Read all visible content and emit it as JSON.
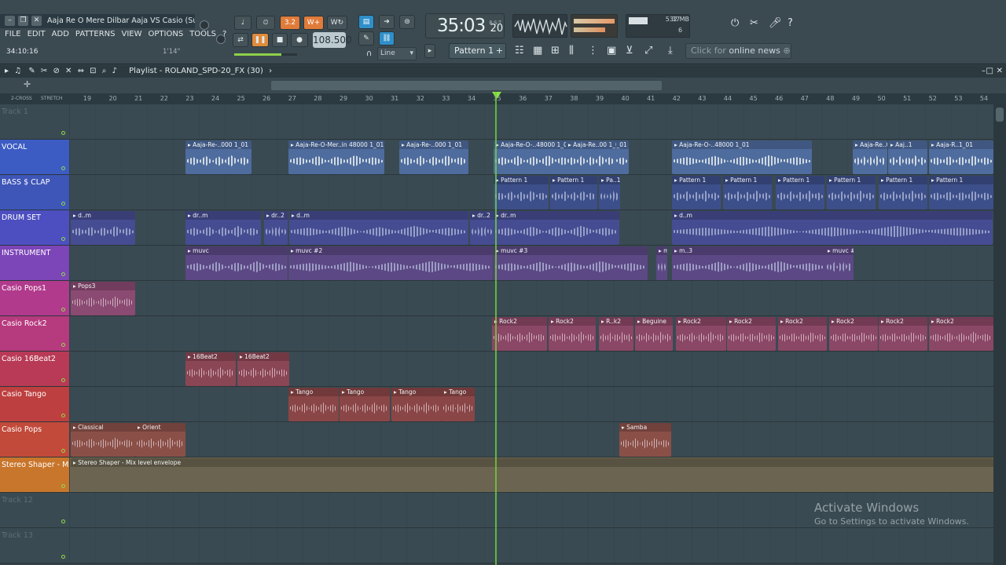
{
  "title": {
    "text": "Aaja Re O Mere Dilbar Aaja VS Casio (Supe..."
  },
  "menu": [
    "FILE",
    "EDIT",
    "ADD",
    "PATTERNS",
    "VIEW",
    "OPTIONS",
    "TOOLS",
    "?"
  ],
  "hint": {
    "left": "34:10:16",
    "right": "1'14\""
  },
  "transport": {
    "tempo": "108.500",
    "clock_main": "35:03",
    "clock_sub": "20",
    "clock_tag": "B:S:T",
    "time_sig": "3.2",
    "snap": "Line"
  },
  "monitor": {
    "cpu": "37",
    "memory": "532 MB",
    "poly": "6"
  },
  "pattern": {
    "label": "Pattern 1"
  },
  "news": {
    "prefix": "Click for",
    "bold": "online news"
  },
  "playlist": {
    "title": "Playlist - ROLAND_SPD-20_FX (30)",
    "ruler_tabs": [
      "2-CROSS",
      "STRETCH"
    ],
    "bars": [
      "19",
      "20",
      "21",
      "22",
      "23",
      "24",
      "25",
      "26",
      "27",
      "28",
      "29",
      "30",
      "31",
      "32",
      "33",
      "34",
      "35",
      "36",
      "37",
      "38",
      "39",
      "40",
      "41",
      "42",
      "43",
      "44",
      "45",
      "46",
      "47",
      "48",
      "49",
      "50",
      "51",
      "52",
      "53",
      "54"
    ]
  },
  "tracks": [
    {
      "name": "Track 1",
      "color": "#3a4a52",
      "clips": []
    },
    {
      "name": "VOCAL",
      "color": "#3c5cc4",
      "clips": [
        {
          "label": "Aaja-Re-..000 1_01",
          "c": "#4f6c9e"
        },
        {
          "label": "Aaja-Re-O-Mer..in 48000 1_01",
          "c": "#4f6c9e"
        },
        {
          "label": "Aaja-Re-..000 1_01",
          "c": "#4f6c9e"
        },
        {
          "label": "Aaja-Re-O-..48000 1_01",
          "c": "#4f6c9e"
        },
        {
          "label": "Aaja-Re..0 1_01",
          "c": "#4f6c9e"
        },
        {
          "label": "Aaja-Re-O-..48000 1_01",
          "c": "#4f6c9e"
        },
        {
          "label": "Aaja-Re..00 1_01",
          "c": "#4f6c9e"
        },
        {
          "label": "Aaj..1",
          "c": "#4f6c9e"
        },
        {
          "label": "Aaja-R..1_01",
          "c": "#4f6c9e"
        },
        {
          "label": "Aaja-Re..00 1_01",
          "c": "#4f6c9e"
        }
      ]
    },
    {
      "name": "BASS $ CLAP",
      "color": "#3e56b8",
      "clips": [
        {
          "label": "Pattern 1",
          "c": "#3d4f8a"
        },
        {
          "label": "Pattern 1",
          "c": "#3d4f8a"
        },
        {
          "label": "Pa..1",
          "c": "#3d4f8a"
        },
        {
          "label": "Pattern 1",
          "c": "#3d4f8a"
        },
        {
          "label": "Pattern 1",
          "c": "#3d4f8a"
        },
        {
          "label": "Pattern 1",
          "c": "#3d4f8a"
        },
        {
          "label": "Pattern 1",
          "c": "#3d4f8a"
        },
        {
          "label": "Pattern 1",
          "c": "#3d4f8a"
        },
        {
          "label": "Pattern 1",
          "c": "#3d4f8a"
        }
      ]
    },
    {
      "name": "DRUM SET",
      "color": "#4d4fc0",
      "clips": [
        {
          "label": "d..m",
          "c": "#464c91"
        },
        {
          "label": "dr..m",
          "c": "#464c91"
        },
        {
          "label": "dr..2",
          "c": "#464c91"
        },
        {
          "label": "d..m",
          "c": "#464c91"
        },
        {
          "label": "dr..2",
          "c": "#464c91"
        },
        {
          "label": "dr..m",
          "c": "#464c91"
        },
        {
          "label": "d..m",
          "c": "#464c91"
        }
      ]
    },
    {
      "name": "INSTRUMENT",
      "color": "#7c45b8",
      "clips": [
        {
          "label": "muvc",
          "c": "#5c4885"
        },
        {
          "label": "muvc #2",
          "c": "#5c4885"
        },
        {
          "label": "muvc #3",
          "c": "#5c4885"
        },
        {
          "label": "muvc #3",
          "c": "#5c4885"
        },
        {
          "label": "m..3",
          "c": "#5c4885"
        },
        {
          "label": "muvc #3",
          "c": "#5c4885"
        }
      ]
    },
    {
      "name": "Casio Pops1",
      "color": "#b13a8d",
      "clips": [
        {
          "label": "Pops3",
          "c": "#8a4a72"
        }
      ]
    },
    {
      "name": "Casio Rock2",
      "color": "#b63a7e",
      "clips": [
        {
          "label": "Rock2",
          "c": "#8b4766"
        },
        {
          "label": "Rock2",
          "c": "#8b4766"
        },
        {
          "label": "R..k2",
          "c": "#8b4766"
        },
        {
          "label": "Beguine",
          "c": "#8b4766"
        },
        {
          "label": "Rock2",
          "c": "#8b4766"
        },
        {
          "label": "Rock2",
          "c": "#8b4766"
        },
        {
          "label": "Rock2",
          "c": "#8b4766"
        },
        {
          "label": "Rock2",
          "c": "#8b4766"
        },
        {
          "label": "Rock2",
          "c": "#8b4766"
        },
        {
          "label": "Rock2",
          "c": "#8b4766"
        }
      ]
    },
    {
      "name": "Casio 16Beat2",
      "color": "#b83a56",
      "clips": [
        {
          "label": "16Beat2",
          "c": "#8b4655"
        },
        {
          "label": "16Beat2",
          "c": "#8b4655"
        }
      ]
    },
    {
      "name": "Casio Tango",
      "color": "#bd3f3f",
      "clips": [
        {
          "label": "Tango",
          "c": "#8a4646"
        },
        {
          "label": "Tango",
          "c": "#8a4646"
        },
        {
          "label": "Tango",
          "c": "#8a4646"
        },
        {
          "label": "Tango",
          "c": "#8a4646"
        }
      ]
    },
    {
      "name": "Casio Pops",
      "color": "#c24a3a",
      "clips": [
        {
          "label": "Classical",
          "c": "#8a5048"
        },
        {
          "label": "Orient",
          "c": "#8a5048"
        },
        {
          "label": "Samba",
          "c": "#8a5048"
        }
      ]
    },
    {
      "name": "Stereo Shaper - Mix level",
      "color": "#c8762c",
      "clips": [
        {
          "label": "Stereo Shaper - Mix level envelope",
          "c": "#6b6450"
        }
      ]
    },
    {
      "name": "Track 12",
      "color": "#3a4a52",
      "clips": []
    },
    {
      "name": "Track 13",
      "color": "#3a4a52",
      "clips": []
    }
  ],
  "watermark": {
    "title": "Activate Windows",
    "sub": "Go to Settings to activate Windows."
  }
}
